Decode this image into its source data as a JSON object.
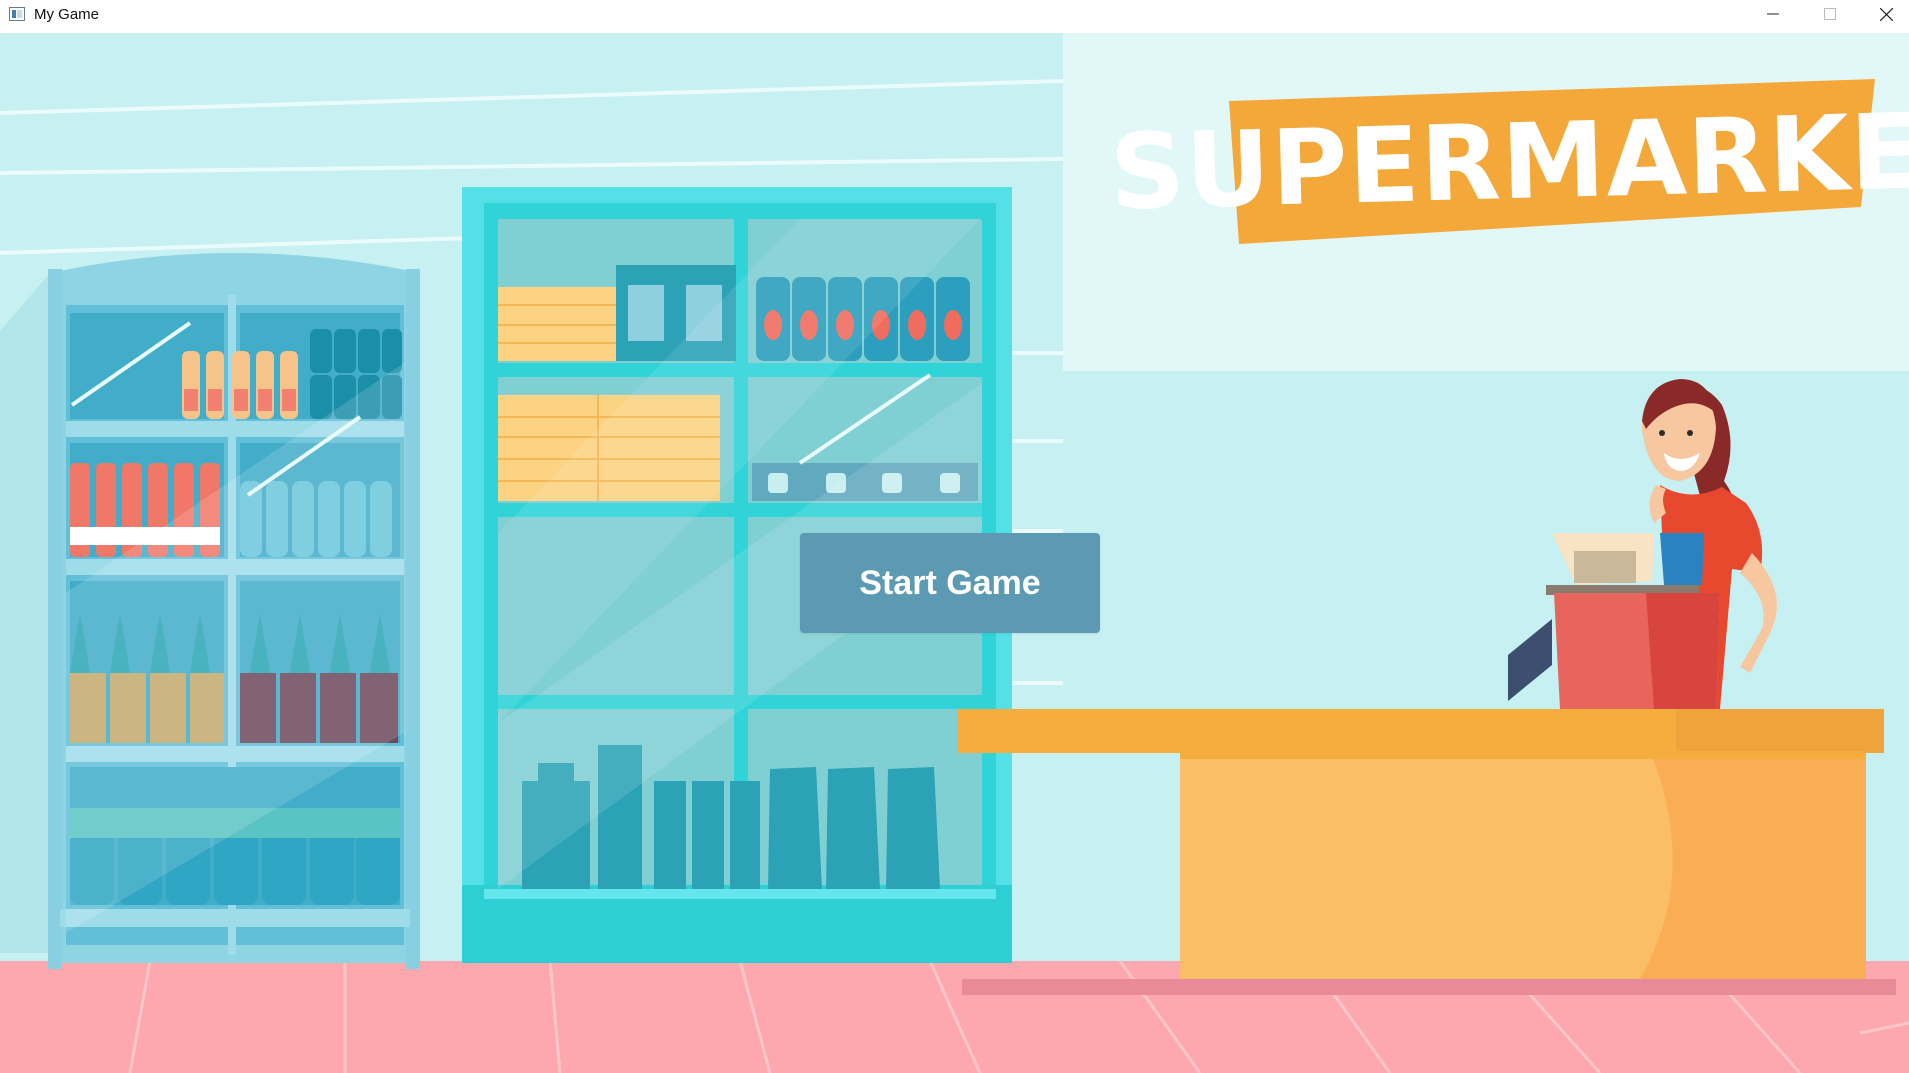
{
  "window": {
    "title": "My Game",
    "icon": "app-window-icon",
    "controls": [
      "minimize-icon",
      "maximize-icon",
      "close-icon"
    ]
  },
  "scene": {
    "sign_text": "SUPERMARKET",
    "start_button_label": "Start Game"
  },
  "colors": {
    "wall": "#c6f0f2",
    "floor": "#fca8ae",
    "sign": "#f5a83a",
    "fridge": "#2fd3d8",
    "counter": "#fbbd66",
    "counter_top": "#f5ae3e",
    "register": "#e8655d",
    "button": "#5b9ab2"
  }
}
